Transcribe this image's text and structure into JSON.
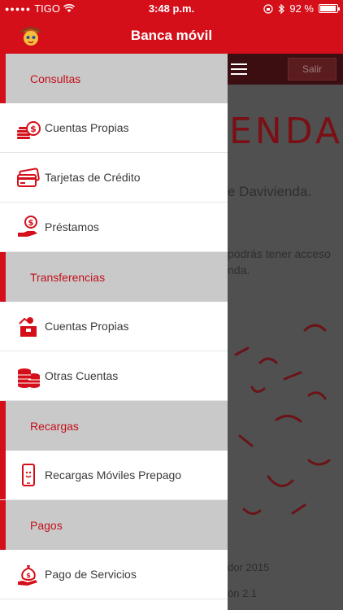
{
  "status_bar": {
    "carrier": "TIGO",
    "time": "3:48 p.m.",
    "battery": "92 %",
    "battery_level": 0.92
  },
  "header": {
    "title": "Banca móvil"
  },
  "background": {
    "logout_label": "Salir",
    "logo_partial": "ENDA",
    "text_1": "e Davivienda.",
    "text_2": "podrás tener acceso",
    "text_3": "nda.",
    "text_4": "dor 2015",
    "text_5": "ón 2.1"
  },
  "drawer": {
    "sections": [
      {
        "label": "Consultas",
        "items": [
          {
            "label": "Cuentas Propias",
            "icon": "coins-dollar-icon"
          },
          {
            "label": "Tarjetas de Crédito",
            "icon": "credit-cards-icon"
          },
          {
            "label": "Préstamos",
            "icon": "loan-hand-icon"
          }
        ]
      },
      {
        "label": "Transferencias",
        "items": [
          {
            "label": "Cuentas Propias",
            "icon": "transfer-box-icon"
          },
          {
            "label": "Otras Cuentas",
            "icon": "coin-stacks-icon"
          }
        ]
      },
      {
        "label": "Recargas",
        "items": [
          {
            "label": "Recargas Móviles Prepago",
            "icon": "mobile-phone-icon"
          }
        ]
      },
      {
        "label": "Pagos",
        "items": [
          {
            "label": "Pago de Servicios",
            "icon": "money-bag-hand-icon"
          }
        ]
      }
    ]
  },
  "colors": {
    "brand_red": "#d40f1a",
    "section_bg": "#c9c9c9"
  }
}
